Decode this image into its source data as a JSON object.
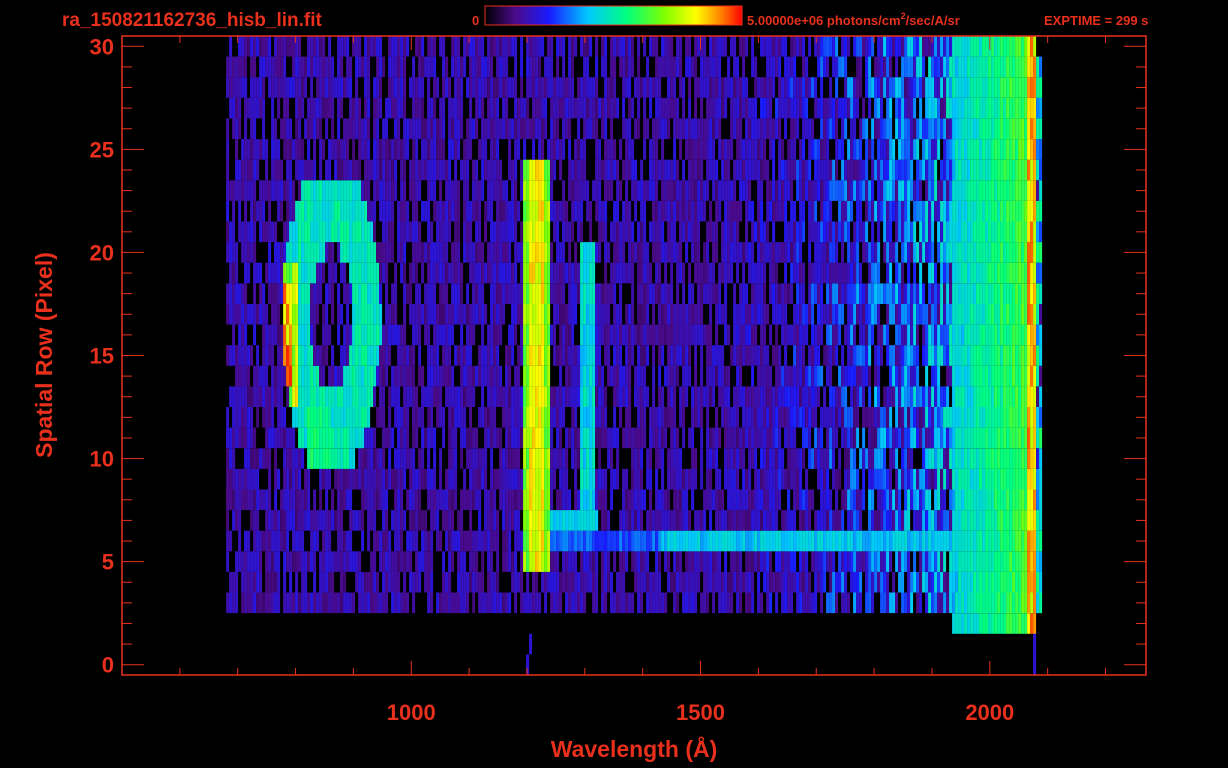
{
  "chart_data": {
    "type": "heatmap",
    "title": "ra_150821162736_hisb_lin.fit",
    "xlabel": "Wavelength (Å)",
    "ylabel": "Spatial Row (Pixel)",
    "xlim": [
      500,
      2270
    ],
    "ylim": [
      -0.5,
      30.5
    ],
    "x_ticks": [
      1000,
      1500,
      2000
    ],
    "y_ticks": [
      0,
      5,
      10,
      15,
      20,
      25,
      30
    ],
    "x_tick_labels": [
      "1000",
      "1500",
      "2000"
    ],
    "y_tick_labels": [
      "0",
      "5",
      "10",
      "15",
      "20",
      "25",
      "30"
    ],
    "colorbar": {
      "min_label": "0",
      "max_label": "5.00000e+06 photons/cm",
      "unit_superscript": "2",
      "unit_suffix": "/sec/A/sr",
      "colormap": "rainbow"
    },
    "annotation": "EXPTIME = 299 s",
    "features": [
      {
        "label": "loop",
        "x_center": 860,
        "row_min": 10,
        "row_max": 23.5,
        "peak_x": 775,
        "peak_rows": [
          13,
          19
        ]
      },
      {
        "label": "line",
        "x": 1215,
        "row_min": 5,
        "row_max": 24,
        "level": 0.85
      },
      {
        "label": "line",
        "x": 1303,
        "row_min": 7,
        "row_max": 20,
        "level": 0.45
      },
      {
        "label": "band",
        "x_min": 1215,
        "x_max": 1960,
        "row": 6.5,
        "level": 0.4
      },
      {
        "label": "edge",
        "x_min": 1930,
        "x_max": 2080,
        "row_min": 2,
        "row_max": 30,
        "level": 0.6
      }
    ],
    "data_extent": {
      "x_min": 680,
      "x_max": 2090,
      "row_min": 3,
      "row_max": 30
    },
    "grid": false
  },
  "colors": {
    "axis": "#e8301c",
    "background": "#000000"
  }
}
